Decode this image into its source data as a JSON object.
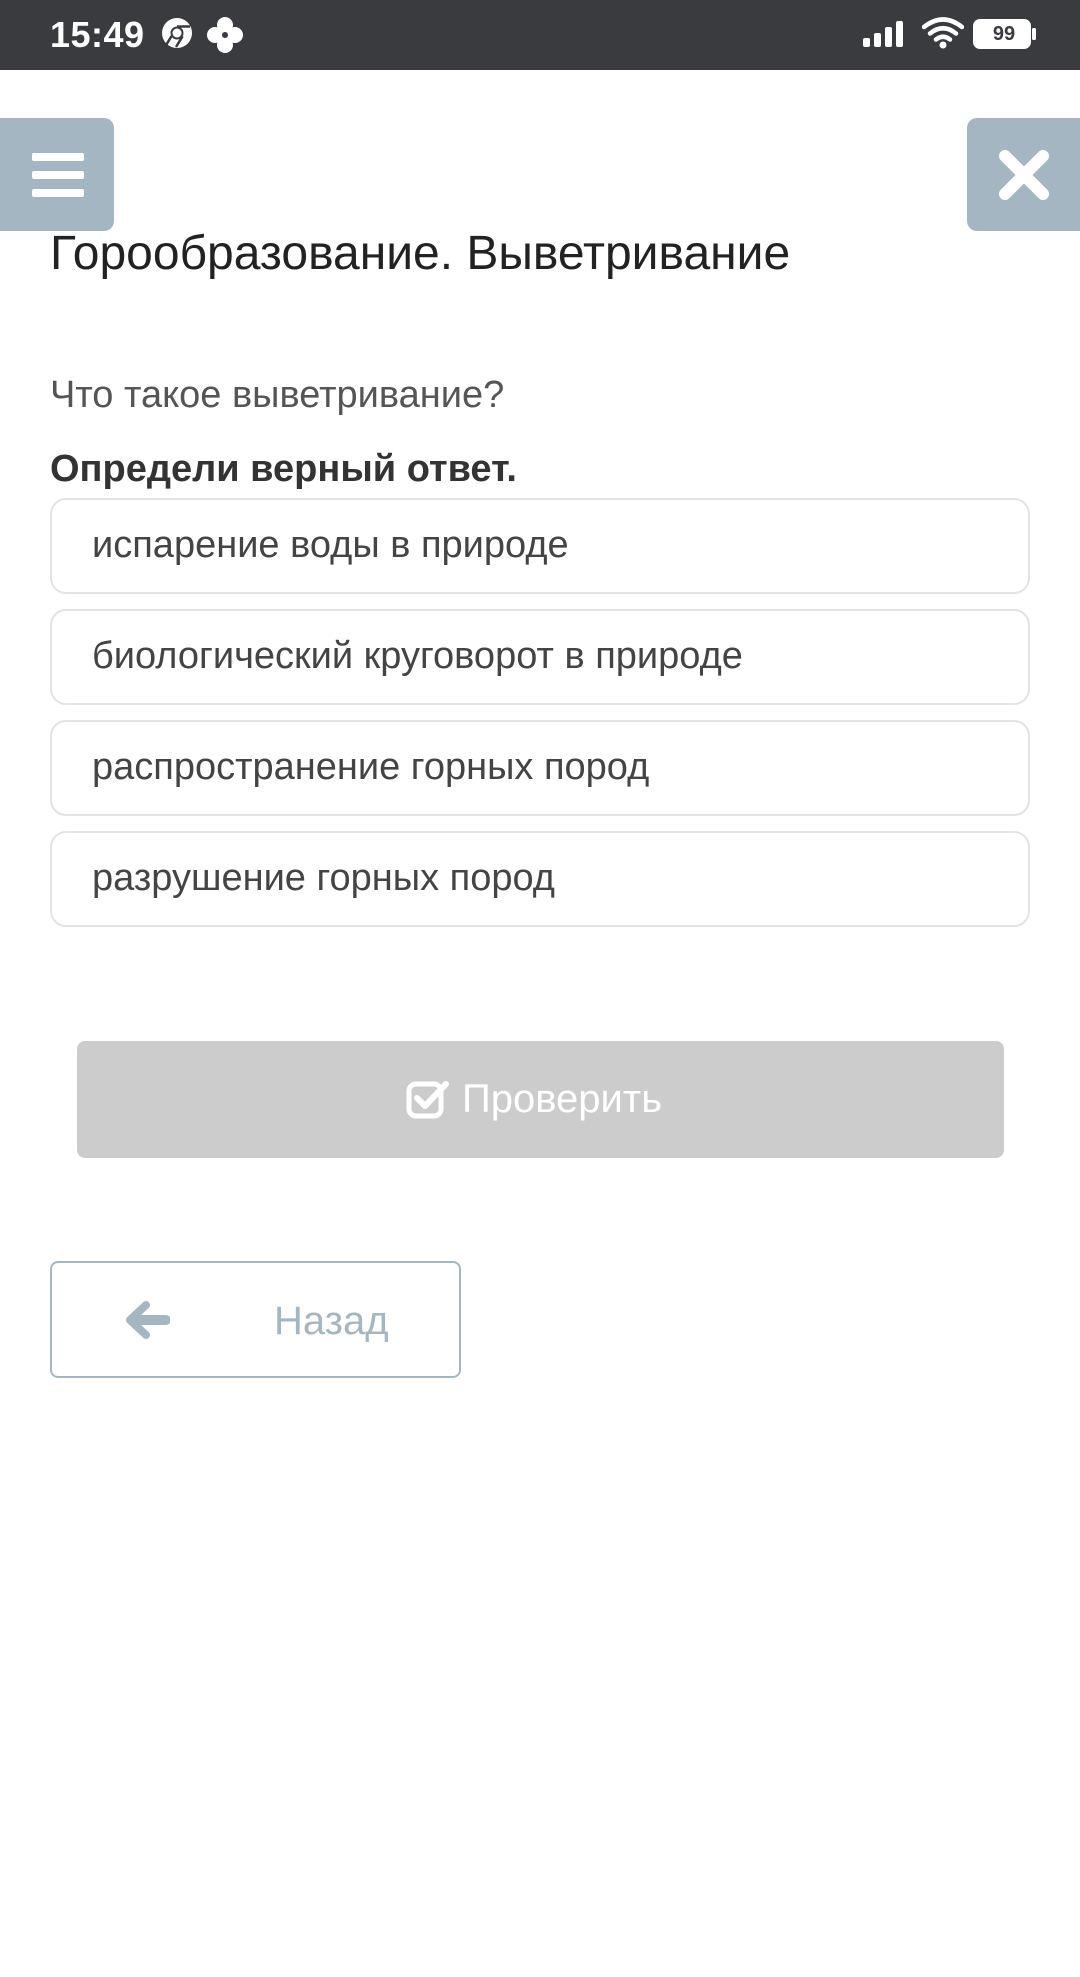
{
  "status_bar": {
    "time": "15:49",
    "battery": "99",
    "icons": [
      "chrome-icon",
      "flower-icon",
      "signal-icon",
      "wifi-icon",
      "battery-icon"
    ]
  },
  "header": {
    "menu_icon": "hamburger-menu-icon",
    "close_icon": "close-icon",
    "accent_color": "#a5b6c3"
  },
  "quiz": {
    "title": "Горообразование. Выветривание",
    "question": "Что такое выветривание?",
    "instruction": "Определи верный ответ.",
    "options": [
      {
        "label": "испарение воды в природе"
      },
      {
        "label": "биологический круговорот в природе"
      },
      {
        "label": "распространение горных пород"
      },
      {
        "label": "разрушение горных пород"
      }
    ]
  },
  "actions": {
    "check_label": "Проверить",
    "check_icon": "checkbox-check-icon",
    "check_color": "#cccccc",
    "back_label": "Назад",
    "back_icon": "arrow-left-icon"
  }
}
